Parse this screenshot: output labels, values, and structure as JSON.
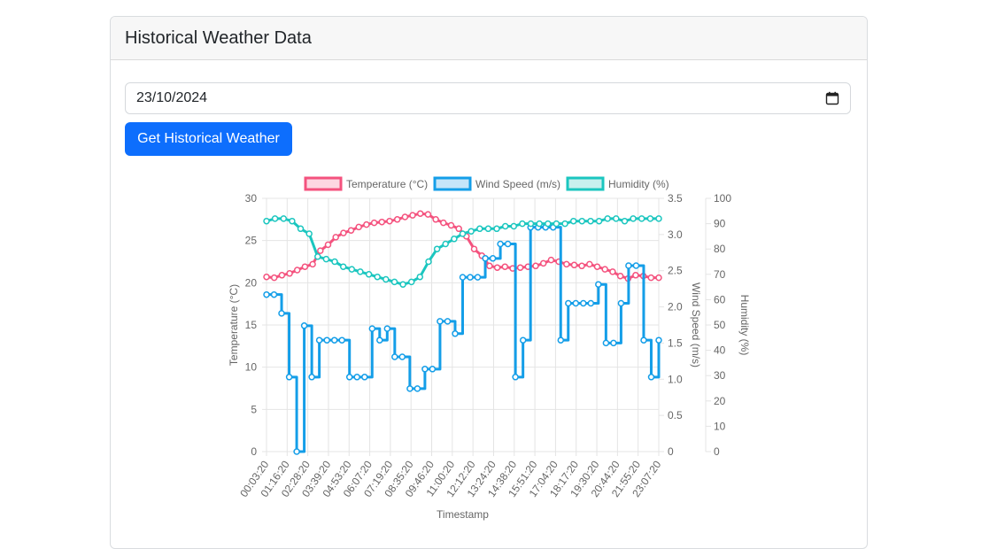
{
  "card": {
    "title": "Historical Weather Data"
  },
  "form": {
    "date_value": "23/10/2024",
    "submit_label": "Get Historical Weather"
  },
  "icons": {
    "date_picker": "calendar-icon"
  },
  "colors": {
    "temperature": "#f4527e",
    "wind": "#149ee8",
    "humidity": "#1bc6bf",
    "button": "#0d6efd"
  },
  "chart_data": {
    "type": "line",
    "xlabel": "Timestamp",
    "x_ticks": [
      "00:03:20",
      "01:16:20",
      "02:28:20",
      "03:39:20",
      "04:53:20",
      "06:07:20",
      "07:19:20",
      "08:35:20",
      "09:46:20",
      "11:00:20",
      "12:12:20",
      "13:24:20",
      "14:38:20",
      "15:51:20",
      "17:04:20",
      "18:17:20",
      "19:30:20",
      "20:44:20",
      "21:55:20",
      "23:07:20"
    ],
    "axes": {
      "y_temp": {
        "label": "Temperature (°C)",
        "range": [
          0,
          30
        ],
        "ticks": [
          "0",
          "5",
          "10",
          "15",
          "20",
          "25",
          "30"
        ]
      },
      "y_wind": {
        "label": "Wind Speed (m/s)",
        "range": [
          0,
          3.5
        ],
        "ticks": [
          "0",
          "0.5",
          "1.0",
          "1.5",
          "2.0",
          "2.5",
          "3.0",
          "3.5"
        ]
      },
      "y_hum": {
        "label": "Humidity (%)",
        "range": [
          0,
          100
        ],
        "ticks": [
          "0",
          "10",
          "20",
          "30",
          "40",
          "50",
          "60",
          "70",
          "80",
          "90",
          "100"
        ]
      }
    },
    "grid": true,
    "legend": "top",
    "series": [
      {
        "name": "Temperature (°C)",
        "axis": "y_temp",
        "values": [
          20.7,
          20.6,
          20.9,
          21.1,
          21.5,
          21.9,
          22.2,
          23.8,
          24.5,
          25.4,
          25.9,
          26.2,
          26.6,
          26.9,
          27.1,
          27.2,
          27.3,
          27.5,
          27.8,
          28.0,
          28.2,
          28.1,
          27.5,
          27.1,
          26.8,
          26.4,
          25.5,
          24.0,
          23.2,
          22.0,
          21.8,
          21.9,
          21.7,
          21.8,
          21.9,
          22.0,
          22.3,
          22.7,
          22.5,
          22.2,
          22.1,
          22.0,
          22.2,
          21.9,
          21.6,
          21.3,
          20.8,
          20.5,
          20.9,
          20.8,
          20.6,
          20.6
        ]
      },
      {
        "name": "Wind Speed (m/s)",
        "axis": "y_wind",
        "values": [
          2.17,
          2.17,
          1.91,
          1.03,
          0.0,
          1.74,
          1.03,
          1.54,
          1.54,
          1.54,
          1.54,
          1.03,
          1.03,
          1.03,
          1.7,
          1.54,
          1.7,
          1.31,
          1.31,
          0.87,
          0.87,
          1.14,
          1.14,
          1.8,
          1.8,
          1.63,
          2.41,
          2.41,
          2.41,
          2.67,
          2.67,
          2.87,
          2.87,
          1.03,
          1.54,
          3.1,
          3.1,
          3.1,
          3.1,
          1.54,
          2.05,
          2.05,
          2.05,
          2.05,
          2.31,
          1.5,
          1.5,
          2.05,
          2.57,
          2.57,
          1.54,
          1.03,
          1.54
        ]
      },
      {
        "name": "Humidity (%)",
        "axis": "y_hum",
        "values": [
          91,
          92,
          92,
          91,
          88,
          86,
          77,
          76,
          75,
          73,
          72,
          71,
          70,
          69,
          68,
          67,
          66,
          67,
          69,
          75,
          80,
          82,
          84,
          86,
          87,
          88,
          88,
          88,
          89,
          89,
          90,
          90,
          90,
          90,
          90,
          90,
          91,
          91,
          91,
          91,
          92,
          92,
          91,
          92,
          92,
          92,
          92
        ]
      }
    ]
  }
}
